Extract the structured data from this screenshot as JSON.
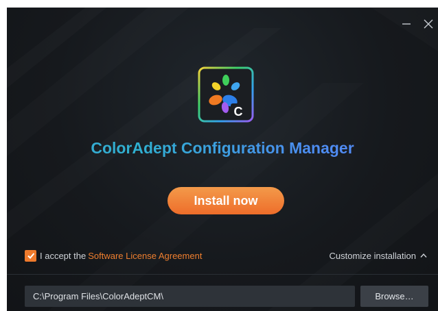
{
  "app": {
    "title": "ColorAdept Configuration Manager",
    "logo_letter": "C"
  },
  "window_controls": {
    "minimize_icon": "minimize-icon",
    "close_icon": "close-icon"
  },
  "main": {
    "install_label": "Install now"
  },
  "license": {
    "checked": true,
    "accept_text": "I accept the",
    "link_text": "Software License Agreement"
  },
  "customize": {
    "label": "Customize installation",
    "icon": "chevron-up-icon"
  },
  "install_path": {
    "value": "C:\\Program Files\\ColorAdeptCM\\",
    "browse_label": "Browse…"
  },
  "colors": {
    "accent": "#ee7a2c",
    "title_start": "#3ea5d6",
    "title_end": "#5a84f4",
    "background": "#16191d"
  }
}
